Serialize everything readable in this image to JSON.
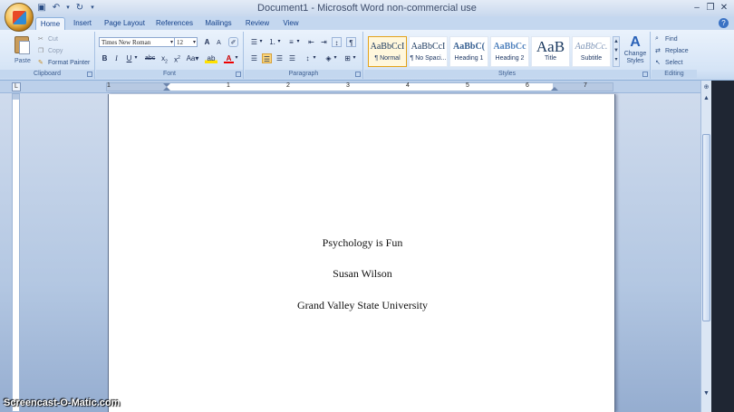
{
  "window": {
    "title": "Document1 - Microsoft Word non-commercial use"
  },
  "tabs": [
    {
      "label": "Home",
      "active": true
    },
    {
      "label": "Insert"
    },
    {
      "label": "Page Layout"
    },
    {
      "label": "References"
    },
    {
      "label": "Mailings"
    },
    {
      "label": "Review"
    },
    {
      "label": "View"
    }
  ],
  "clipboard": {
    "paste": "Paste",
    "cut": "Cut",
    "copy": "Copy",
    "format_painter": "Format Painter",
    "group": "Clipboard"
  },
  "font": {
    "family": "Times New Roman",
    "size": "12",
    "group": "Font"
  },
  "paragraph": {
    "group": "Paragraph"
  },
  "styles": {
    "group": "Styles",
    "items": [
      {
        "sample": "AaBbCcI",
        "name": "¶ Normal",
        "selected": true
      },
      {
        "sample": "AaBbCcI",
        "name": "¶ No Spaci..."
      },
      {
        "sample": "AaBbC(",
        "name": "Heading 1"
      },
      {
        "sample": "AaBbCc",
        "name": "Heading 2"
      },
      {
        "sample": "AaB",
        "name": "Title"
      },
      {
        "sample": "AaBbCc.",
        "name": "Subtitle"
      }
    ],
    "change_styles": "Change Styles"
  },
  "editing": {
    "find": "Find",
    "replace": "Replace",
    "select": "Select",
    "group": "Editing"
  },
  "ruler": {
    "numbers": [
      "1",
      "1",
      "2",
      "3",
      "4",
      "5",
      "6",
      "7"
    ]
  },
  "document": {
    "lines": [
      "Psychology is Fun",
      "Susan Wilson",
      "Grand Valley State University"
    ]
  },
  "watermark": "Screencast-O-Matic.com",
  "icons": {
    "office": "office-button-icon",
    "save": "save-icon",
    "undo": "undo-icon",
    "redo": "redo-icon"
  }
}
